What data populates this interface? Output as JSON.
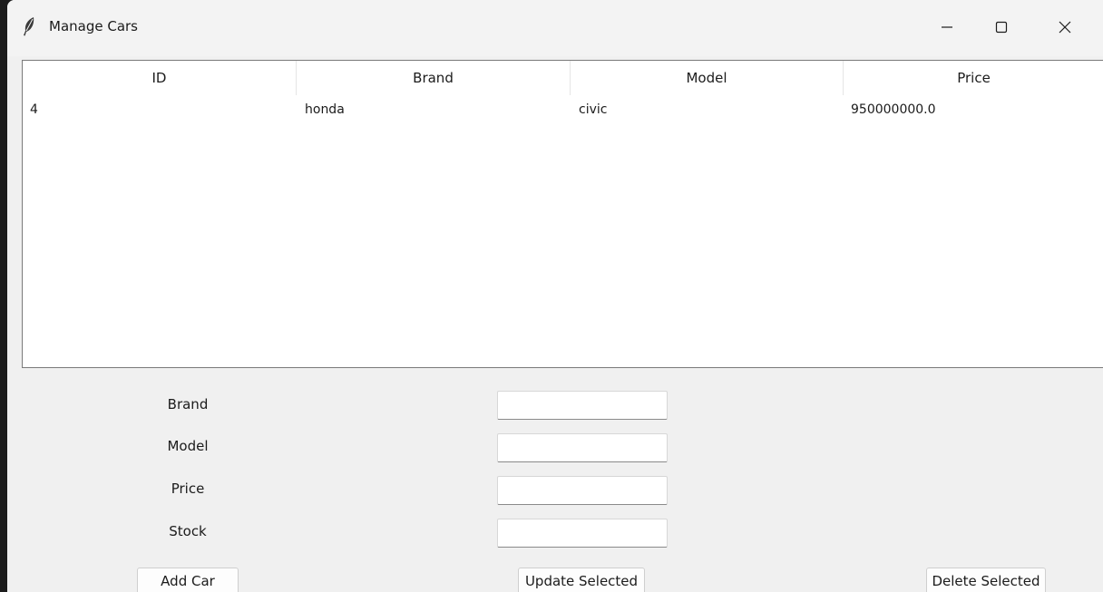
{
  "window": {
    "title": "Manage Cars",
    "app_icon": "feather-icon"
  },
  "titlebar_controls": [
    "minimize-icon",
    "maximize-icon",
    "close-icon"
  ],
  "table": {
    "columns": [
      "ID",
      "Brand",
      "Model",
      "Price"
    ],
    "rows": [
      {
        "id": "4",
        "brand": "honda",
        "model": "civic",
        "price": "950000000.0"
      }
    ]
  },
  "form": {
    "fields": [
      {
        "label": "Brand",
        "value": ""
      },
      {
        "label": "Model",
        "value": ""
      },
      {
        "label": "Price",
        "value": ""
      },
      {
        "label": "Stock",
        "value": ""
      }
    ]
  },
  "actions": {
    "add": "Add Car",
    "update": "Update Selected",
    "delete": "Delete Selected"
  }
}
